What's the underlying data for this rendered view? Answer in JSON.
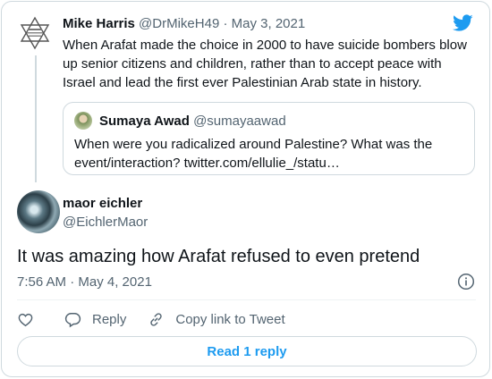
{
  "parent_tweet": {
    "author_name": "Mike Harris",
    "handle": "@DrMikeH49",
    "separator": " · ",
    "date": "May 3, 2021",
    "text": "When Arafat made the choice in 2000 to have suicide bombers blow up senior citizens and children, rather than to accept peace with Israel and lead the first ever Palestinian Arab state in history."
  },
  "quoted_tweet": {
    "author_name": "Sumaya Awad",
    "handle": "@sumayaawad",
    "text": "When were you radicalized around Palestine? What was the event/interaction? twitter.com/ellulie_/statu…"
  },
  "main_tweet": {
    "author_name": "maor eichler",
    "handle": "@EichlerMaor",
    "text": "It was amazing how Arafat refused to even pretend",
    "timestamp": "7:56 AM · May 4, 2021"
  },
  "actions": {
    "reply_label": "Reply",
    "copy_link_label": "Copy link to Tweet"
  },
  "read_reply_label": "Read 1 reply",
  "icons": {
    "brand": "twitter-bird-icon",
    "info": "info-icon",
    "like": "heart-icon",
    "reply": "speech-bubble-icon",
    "copy_link": "link-icon"
  },
  "colors": {
    "accent": "#1d9bf0",
    "text_primary": "#0f1419",
    "text_secondary": "#536471",
    "border": "#cfd9de"
  }
}
